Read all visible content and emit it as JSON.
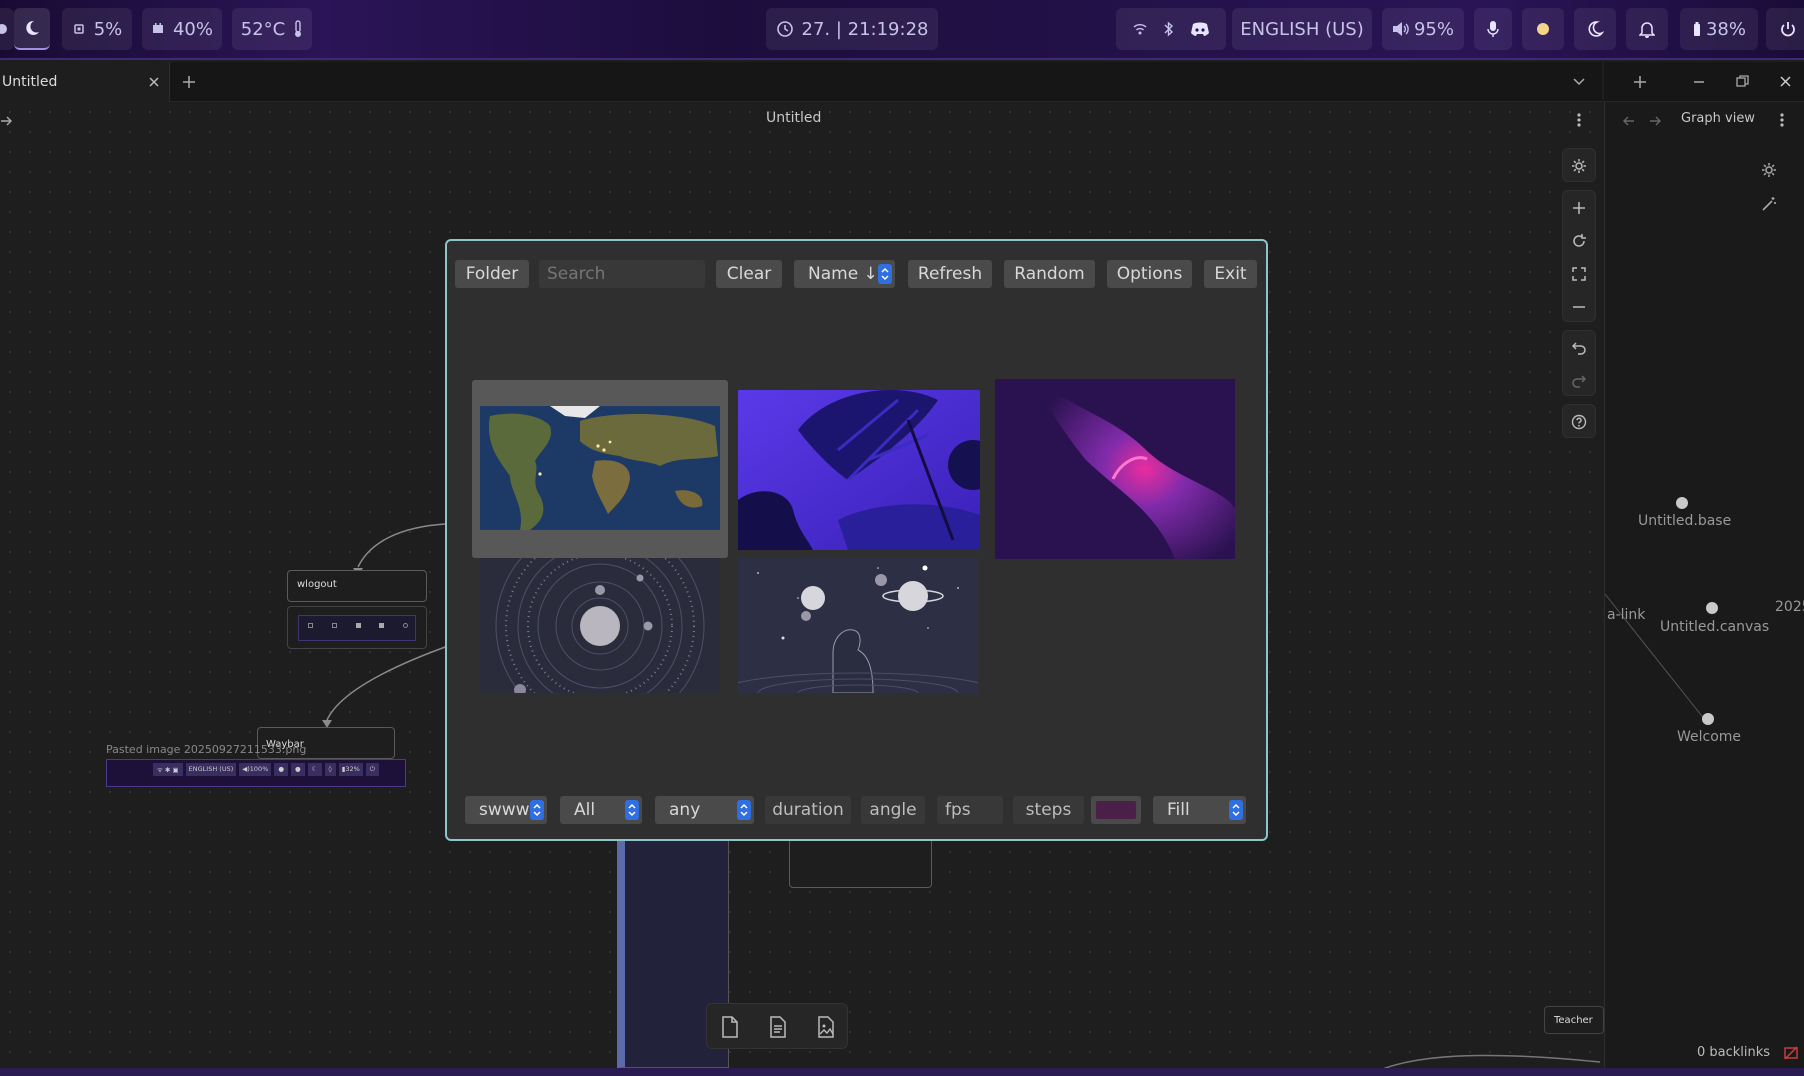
{
  "topbar": {
    "cpu": "5%",
    "memory": "40%",
    "temperature": "52°C",
    "clock": "27. | 21:19:28",
    "language": "ENGLISH (US)",
    "volume": "95%",
    "battery": "38%"
  },
  "app": {
    "tab_title": "Untitled",
    "canvas_title": "Untitled",
    "graph_title": "Graph view",
    "backlinks": "0 backlinks"
  },
  "canvas": {
    "node_wlogout": "wlogout",
    "node_waybar": "Waybar",
    "pasted_image_caption": "Pasted image 20250927211533.png",
    "mini_lang": "ENGLISH (US)",
    "mini_vol": "◀)100%",
    "mini_bat": "▮32%",
    "node_teacher": "Teacher"
  },
  "graph": {
    "nodes": [
      "Untitled.base",
      "Untitled.canvas",
      "Welcome"
    ],
    "edge_label": "a-link",
    "partial_label": "2025"
  },
  "picker": {
    "buttons": {
      "folder": "Folder",
      "clear": "Clear",
      "sort": "Name ↓",
      "refresh": "Refresh",
      "random": "Random",
      "options": "Options",
      "exit": "Exit"
    },
    "search_placeholder": "Search",
    "backend": "swww",
    "filter": "All",
    "transition": "any",
    "duration_placeholder": "duration",
    "angle_placeholder": "angle",
    "fps_placeholder": "fps",
    "steps_placeholder": "steps",
    "fill_color": "#4a1f48",
    "fill_mode": "Fill"
  },
  "colors": {
    "accent": "#2f6fe0",
    "dialog_border": "#8ec5c8",
    "topbar": "#2b1457"
  }
}
